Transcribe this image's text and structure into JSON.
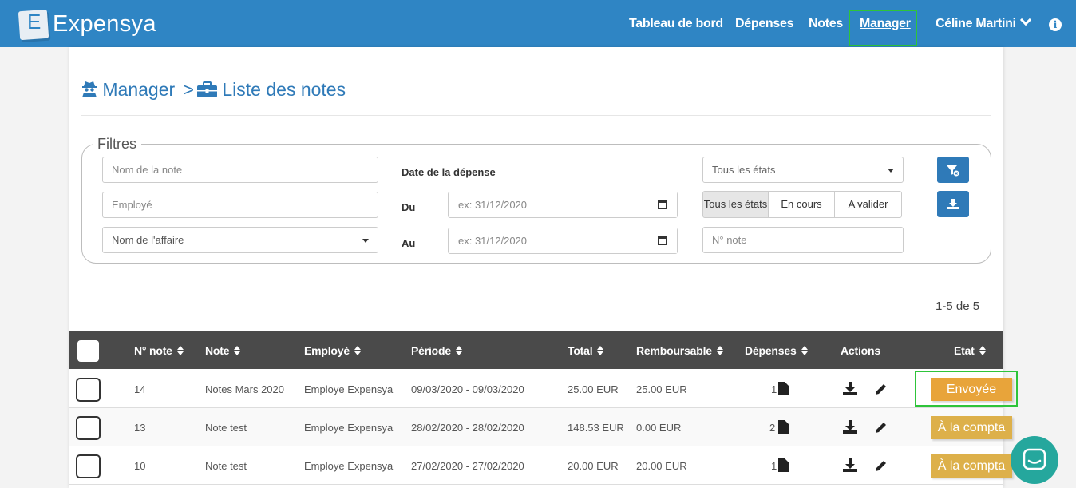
{
  "brand": {
    "logo_letter": "E",
    "name": "Expensya"
  },
  "nav": {
    "items": [
      "Tableau de bord",
      "Dépenses",
      "Notes",
      "Manager"
    ],
    "user": "Céline Martini"
  },
  "breadcrumb": {
    "level1": "Manager",
    "separator": ">",
    "level2": "Liste des notes"
  },
  "filters": {
    "legend": "Filtres",
    "note_name_placeholder": "Nom de la note",
    "employee_placeholder": "Employé",
    "affaire_placeholder": "Nom de l'affaire",
    "date_label": "Date de la dépense",
    "from_label": "Du",
    "to_label": "Au",
    "date_placeholder": "ex: 31/12/2020",
    "state_select": "Tous les états",
    "state_buttons": [
      "Tous les états",
      "En cours",
      "A valider"
    ],
    "note_number_placeholder": "N° note"
  },
  "pagination": {
    "count": "1-5 de 5"
  },
  "table": {
    "columns": [
      "N° note",
      "Note",
      "Employé",
      "Période",
      "Total",
      "Remboursable",
      "Dépenses",
      "Actions",
      "Etat"
    ],
    "rows": [
      {
        "num": "14",
        "note": "Notes Mars 2020",
        "employee": "Employe Expensya",
        "period": "09/03/2020 - 09/03/2020",
        "total": "25.00 EUR",
        "refund": "25.00 EUR",
        "expenses": "1",
        "status": "Envoyée"
      },
      {
        "num": "13",
        "note": "Note test",
        "employee": "Employe Expensya",
        "period": "28/02/2020 - 28/02/2020",
        "total": "148.53 EUR",
        "refund": "0.00 EUR",
        "expenses": "2",
        "status": "À la compta"
      },
      {
        "num": "10",
        "note": "Note test",
        "employee": "Employe Expensya",
        "period": "27/02/2020 - 27/02/2020",
        "total": "20.00 EUR",
        "refund": "20.00 EUR",
        "expenses": "1",
        "status": "À la compta"
      }
    ]
  },
  "colors": {
    "brand_blue": "#2f85c4",
    "status_sent": "#e8a43a",
    "status_compta": "#ddb04a",
    "highlight_green": "#2ec43a",
    "chat": "#25a79d"
  },
  "icons": [
    "spy-icon",
    "briefcase-icon",
    "filter-clear-icon",
    "download-icon",
    "calendar-icon",
    "file-icon",
    "pencil-icon",
    "info-icon",
    "chat-icon",
    "chevron-down-icon"
  ]
}
